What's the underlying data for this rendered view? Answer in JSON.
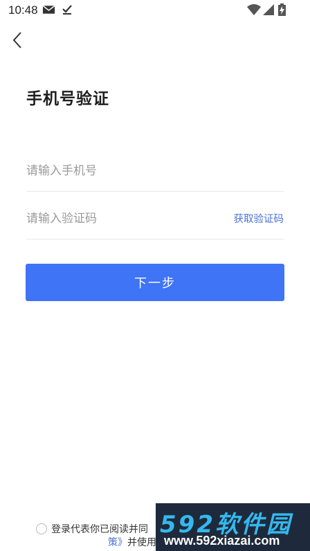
{
  "status_bar": {
    "time": "10:48",
    "left_icons": [
      "mail-icon",
      "download-done-icon"
    ],
    "right_icons": [
      "wifi-icon",
      "signal-icon",
      "battery-charging-icon"
    ]
  },
  "nav": {
    "back_icon": "chevron-left-icon"
  },
  "page": {
    "title": "手机号验证"
  },
  "form": {
    "phone": {
      "placeholder": "请输入手机号",
      "value": ""
    },
    "code": {
      "placeholder": "请输入验证码",
      "value": "",
      "get_code_label": "获取验证码"
    },
    "next_label": "下一步"
  },
  "agreement": {
    "text_line1": "登录代表你已阅读并同",
    "link_tail": "策》",
    "text_line2": "并使用"
  },
  "watermark": {
    "brand": "592软件园",
    "url": "www.592xiazai.com"
  },
  "colors": {
    "primary_button": "#3f74f6",
    "link": "#4a73d6",
    "placeholder": "#9a9a9a",
    "divider": "#e9e9e9",
    "watermark_bg": "#1e2a3c",
    "watermark_brand": "#35b8ee"
  }
}
